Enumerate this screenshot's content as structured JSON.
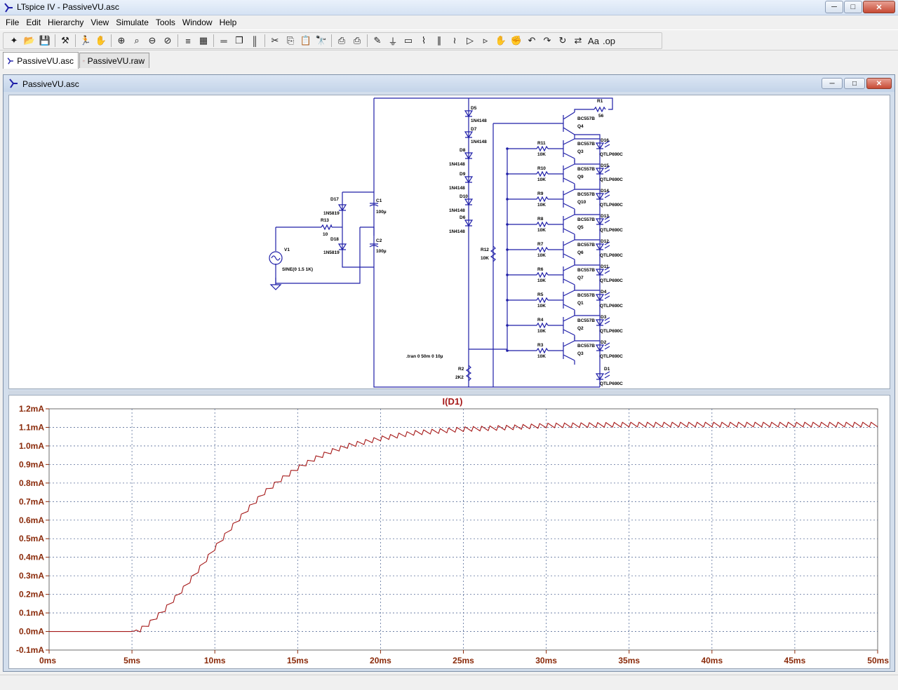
{
  "window": {
    "title": "LTspice IV - PassiveVU.asc",
    "controls": {
      "minimize": "─",
      "maximize": "□",
      "close": "✕"
    }
  },
  "menu": [
    "File",
    "Edit",
    "Hierarchy",
    "View",
    "Simulate",
    "Tools",
    "Window",
    "Help"
  ],
  "toolbar": {
    "icons": [
      "new-schematic-icon",
      "open-icon",
      "save-icon",
      "control-panel-icon",
      "run-icon",
      "halt-icon",
      "zoom-in-icon",
      "zoom-pan-icon",
      "zoom-out-icon",
      "zoom-fit-icon",
      "autorange-icon",
      "grid-icon",
      "tile-horizontal-icon",
      "cascade-icon",
      "tile-vertical-icon",
      "cut-icon",
      "copy-icon",
      "paste-icon",
      "find-icon",
      "print-setup-icon",
      "print-icon",
      "wire-icon",
      "ground-icon",
      "label-icon",
      "resistor-icon",
      "capacitor-icon",
      "inductor-icon",
      "diode-icon",
      "component-icon",
      "move-icon",
      "drag-icon",
      "undo-icon",
      "redo-icon",
      "rotate-icon",
      "mirror-icon",
      "text-icon",
      "spice-directive-icon"
    ],
    "glyphs": [
      "✦",
      "📂",
      "💾",
      "⚒",
      "🏃",
      "✋",
      "⊕",
      "⌕",
      "⊖",
      "⊘",
      "≡",
      "▦",
      "═",
      "❐",
      "║",
      "✂",
      "⎘",
      "📋",
      "🔭",
      "⎙",
      "⎙",
      "✎",
      "⏚",
      "▭",
      "⌇",
      "∥",
      "≀",
      "▷",
      "▹",
      "✋",
      "✊",
      "↶",
      "↷",
      "↻",
      "⇄",
      "Aa",
      ".op"
    ]
  },
  "tabs": [
    {
      "label": "PassiveVU.asc",
      "active": true
    },
    {
      "label": "PassiveVU.raw",
      "active": false
    }
  ],
  "schematic_window": {
    "title": "PassiveVU.asc",
    "controls": {
      "minimize": "─",
      "maximize": "□",
      "close": "✕"
    },
    "directive": ".tran 0 50m 0 10µ",
    "source": {
      "name": "V1",
      "value": "SINE(0 1.5 1K)"
    },
    "r13": {
      "name": "R13",
      "value": "10"
    },
    "d17": {
      "name": "D17",
      "model": "1N5819"
    },
    "d18": {
      "name": "D18",
      "model": "1N5819"
    },
    "c1": {
      "name": "C1",
      "value": "100µ"
    },
    "c2": {
      "name": "C2",
      "value": "100µ"
    },
    "r1": {
      "name": "R1",
      "value": "56"
    },
    "q4": {
      "name": "Q4",
      "model": "BC557B"
    },
    "r12": {
      "name": "R12",
      "value": "10K"
    },
    "r2": {
      "name": "R2",
      "value": "2K2"
    },
    "diode_chain": [
      {
        "name": "D5",
        "model": "1N4148"
      },
      {
        "name": "D7",
        "model": "1N4148"
      },
      {
        "name": "D8",
        "model": "1N4148"
      },
      {
        "name": "D9",
        "model": "1N4148"
      },
      {
        "name": "D10",
        "model": "1N4148"
      },
      {
        "name": "D6",
        "model": "1N4148"
      }
    ],
    "stages": [
      {
        "r": "R11",
        "rv": "10K",
        "q": "Q3",
        "qm": "BC557B",
        "d": "D16",
        "dm": "QTLP690C"
      },
      {
        "r": "R10",
        "rv": "10K",
        "q": "Q9",
        "qm": "BC557B",
        "d": "D15",
        "dm": "QTLP690C"
      },
      {
        "r": "R9",
        "rv": "10K",
        "q": "Q10",
        "qm": "BC557B",
        "d": "D14",
        "dm": "QTLP690C"
      },
      {
        "r": "R8",
        "rv": "10K",
        "q": "Q5",
        "qm": "BC557B",
        "d": "D13",
        "dm": "QTLP690C"
      },
      {
        "r": "R7",
        "rv": "10K",
        "q": "Q6",
        "qm": "BC557B",
        "d": "D12",
        "dm": "QTLP690C"
      },
      {
        "r": "R6",
        "rv": "10K",
        "q": "Q7",
        "qm": "BC557B",
        "d": "D11",
        "dm": "QTLP690C"
      },
      {
        "r": "R5",
        "rv": "10K",
        "q": "Q1",
        "qm": "BC557B",
        "d": "D4",
        "dm": "QTLP690C"
      },
      {
        "r": "R4",
        "rv": "10K",
        "q": "Q2",
        "qm": "BC557B",
        "d": "D3",
        "dm": "QTLP690C"
      },
      {
        "r": "R3",
        "rv": "10K",
        "q": "Q3",
        "qm": "BC557B",
        "d": "D2",
        "dm": "QTLP690C"
      }
    ],
    "d1": {
      "name": "D1",
      "model": "QTLP690C"
    }
  },
  "waveform": {
    "colors": {
      "trace": "#a51717",
      "grid": "#5a6f9a",
      "axis": "#8a2a0a"
    },
    "chart_data": {
      "type": "line",
      "title": "I(D1)",
      "xlabel": "",
      "ylabel": "",
      "xlim": [
        0,
        50
      ],
      "ylim": [
        -0.1,
        1.2
      ],
      "x_ticks": [
        "0ms",
        "5ms",
        "10ms",
        "15ms",
        "20ms",
        "25ms",
        "30ms",
        "35ms",
        "40ms",
        "45ms",
        "50ms"
      ],
      "y_ticks": [
        "1.2mA",
        "1.1mA",
        "1.0mA",
        "0.9mA",
        "0.8mA",
        "0.7mA",
        "0.6mA",
        "0.5mA",
        "0.4mA",
        "0.3mA",
        "0.2mA",
        "0.1mA",
        "0.0mA",
        "-0.1mA"
      ],
      "grid": true,
      "series": [
        {
          "name": "I(D1)",
          "x_unit": "ms",
          "y_unit": "mA",
          "points": [
            [
              0,
              0
            ],
            [
              5,
              0
            ],
            [
              5.5,
              0.01
            ],
            [
              6,
              0.04
            ],
            [
              7,
              0.12
            ],
            [
              8,
              0.22
            ],
            [
              9,
              0.33
            ],
            [
              10,
              0.45
            ],
            [
              11,
              0.56
            ],
            [
              12,
              0.66
            ],
            [
              13,
              0.75
            ],
            [
              14,
              0.82
            ],
            [
              15,
              0.88
            ],
            [
              16,
              0.93
            ],
            [
              17,
              0.97
            ],
            [
              18,
              1.0
            ],
            [
              20,
              1.04
            ],
            [
              22,
              1.07
            ],
            [
              25,
              1.09
            ],
            [
              28,
              1.1
            ],
            [
              30,
              1.11
            ],
            [
              35,
              1.115
            ],
            [
              40,
              1.115
            ],
            [
              45,
              1.115
            ],
            [
              50,
              1.115
            ]
          ],
          "ripple": {
            "period_ms": 0.5,
            "amplitude_ma": 0.025
          }
        }
      ]
    }
  }
}
